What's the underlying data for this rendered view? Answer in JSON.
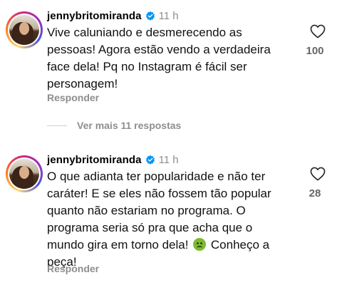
{
  "comments": [
    {
      "username": "jennybritomiranda",
      "time": "11 h",
      "text": "Vive caluniando e desmerecendo as pessoas! Agora estão vendo a verdadeira face dela! Pq no Instagram é fácil ser personagem!",
      "reply_label": "Responder",
      "likes": "100"
    },
    {
      "username": "jennybritomiranda",
      "time": "11 h",
      "text_before_emoji": "O que adianta ter popularidade e não ter caráter! E se eles não fossem tão popular quanto não estariam no programa. O programa seria só pra que acha que o mundo gira em torno dela! ",
      "emoji": "nauseated-face",
      "text_after_emoji": " Conheço a peça!",
      "reply_label": "Responder",
      "likes": "28"
    }
  ],
  "more_replies_label": "Ver mais 11 respostas",
  "colors": {
    "secondary_text": "#8e8e8e",
    "verified_blue": "#0095f6"
  }
}
